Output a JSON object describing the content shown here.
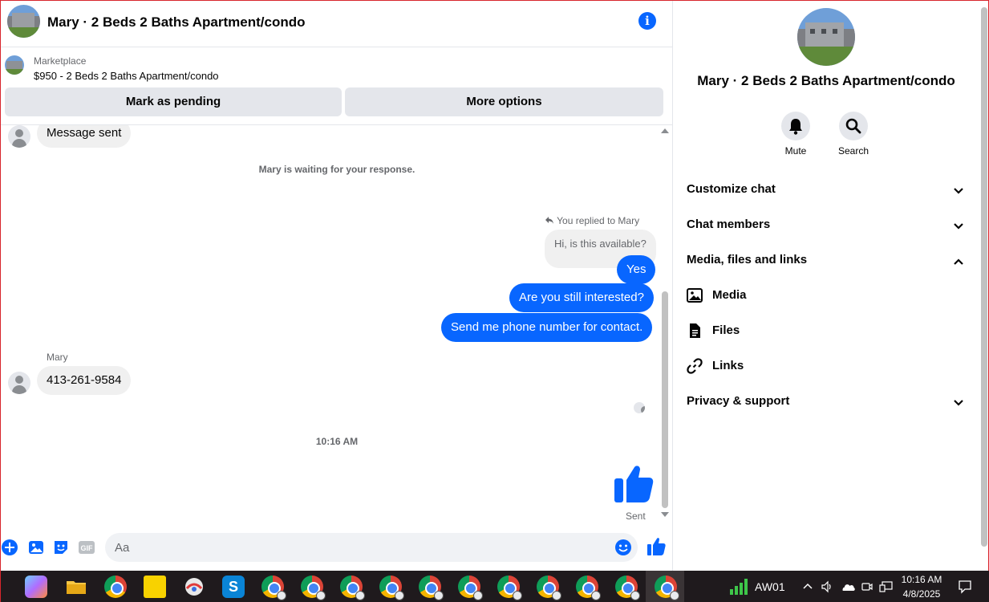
{
  "header": {
    "title": "Mary · 2 Beds 2 Baths Apartment/condo",
    "info_icon": "info-icon"
  },
  "marketplace": {
    "label": "Marketplace",
    "listing": "$950 - 2 Beds 2 Baths Apartment/condo",
    "mark_pending": "Mark as pending",
    "more_options": "More options"
  },
  "thread": {
    "msg_sent": "Message sent",
    "waiting": "Mary is waiting for your response.",
    "replied_to": "You replied to Mary",
    "quoted": "Hi, is this available?",
    "out1": "Yes",
    "out2": "Are you still interested?",
    "out3": "Send me phone number for contact.",
    "sender": "Mary",
    "in1": "413-261-9584",
    "time": "10:16 AM",
    "sent_status": "Sent"
  },
  "composer": {
    "placeholder": "Aa"
  },
  "panel": {
    "title": "Mary · 2 Beds 2 Baths Apartment/condo",
    "mute": "Mute",
    "search": "Search",
    "customize": "Customize chat",
    "members": "Chat members",
    "media_files": "Media, files and links",
    "media": "Media",
    "files": "Files",
    "links": "Links",
    "privacy": "Privacy & support"
  },
  "taskbar": {
    "account": "AW01",
    "time": "10:16 AM",
    "date": "4/8/2025"
  },
  "colors": {
    "accent": "#0866ff",
    "bubble_in": "#f0f0f0",
    "button_bg": "#e4e6eb"
  }
}
